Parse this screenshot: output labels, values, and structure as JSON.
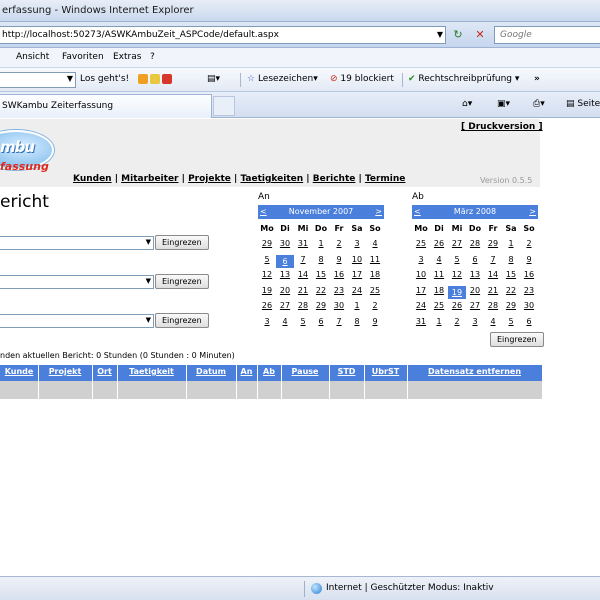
{
  "window": {
    "title": "erfassung - Windows Internet Explorer"
  },
  "address_bar": {
    "url": "http://localhost:50273/ASWKAmbuZeit_ASPCode/default.aspx",
    "search_placeholder": "Google"
  },
  "menu": [
    "Ansicht",
    "Favoriten",
    "Extras",
    "?"
  ],
  "toolbar": {
    "search_go": "Los geht's!",
    "bookmarks": "Lesezeichen",
    "blocked": "19 blockiert",
    "spellcheck": "Rechtschreibprüfung",
    "more": "»"
  },
  "tab": {
    "title": "SWKambu Zeiterfassung",
    "page_menu": "Seite"
  },
  "page": {
    "print_link": "[ Druckversion ]",
    "logo_word": "mbu",
    "logo_sub": "fassung",
    "nav": [
      "Kunden",
      "Mitarbeiter",
      "Projekte",
      "Taetigkeiten",
      "Berichte",
      "Termine"
    ],
    "version": "Version 0.5.5",
    "heading": "ericht",
    "filter_button": "Eingrezen",
    "summary": "nden aktuellen Bericht: 0 Stunden (0 Stunden : 0 Minuten)"
  },
  "calendar_from": {
    "label": "An",
    "prev": "<",
    "next": ">",
    "month": "November 2007",
    "weekdays": [
      "Mo",
      "Di",
      "Mi",
      "Do",
      "Fr",
      "Sa",
      "So"
    ],
    "days": [
      [
        "29",
        "30",
        "31",
        "1",
        "2",
        "3",
        "4"
      ],
      [
        "5",
        "6",
        "7",
        "8",
        "9",
        "10",
        "11"
      ],
      [
        "12",
        "13",
        "14",
        "15",
        "16",
        "17",
        "18"
      ],
      [
        "19",
        "20",
        "21",
        "22",
        "23",
        "24",
        "25"
      ],
      [
        "26",
        "27",
        "28",
        "29",
        "30",
        "1",
        "2"
      ],
      [
        "3",
        "4",
        "5",
        "6",
        "7",
        "8",
        "9"
      ]
    ],
    "selected": "6"
  },
  "calendar_to": {
    "label": "Ab",
    "prev": "<",
    "next": ">",
    "month": "März 2008",
    "weekdays": [
      "Mo",
      "Di",
      "Mi",
      "Do",
      "Fr",
      "Sa",
      "So"
    ],
    "days": [
      [
        "25",
        "26",
        "27",
        "28",
        "29",
        "1",
        "2"
      ],
      [
        "3",
        "4",
        "5",
        "6",
        "7",
        "8",
        "9"
      ],
      [
        "10",
        "11",
        "12",
        "13",
        "14",
        "15",
        "16"
      ],
      [
        "17",
        "18",
        "19",
        "20",
        "21",
        "22",
        "23"
      ],
      [
        "24",
        "25",
        "26",
        "27",
        "28",
        "29",
        "30"
      ],
      [
        "31",
        "1",
        "2",
        "3",
        "4",
        "5",
        "6"
      ]
    ],
    "selected": "19"
  },
  "calendar_button": "Eingrezen",
  "grid": {
    "columns": [
      "Kunde",
      "Projekt",
      "Ort",
      "Taetigkeit",
      "Datum",
      "An",
      "Ab",
      "Pause",
      "STD",
      "UbrST",
      "Datensatz entfernen"
    ]
  },
  "status": {
    "zone": "Internet | Geschützter Modus: Inaktiv"
  },
  "colors": {
    "accent": "#4a7fdc",
    "chrome": "#c9d8ee"
  }
}
